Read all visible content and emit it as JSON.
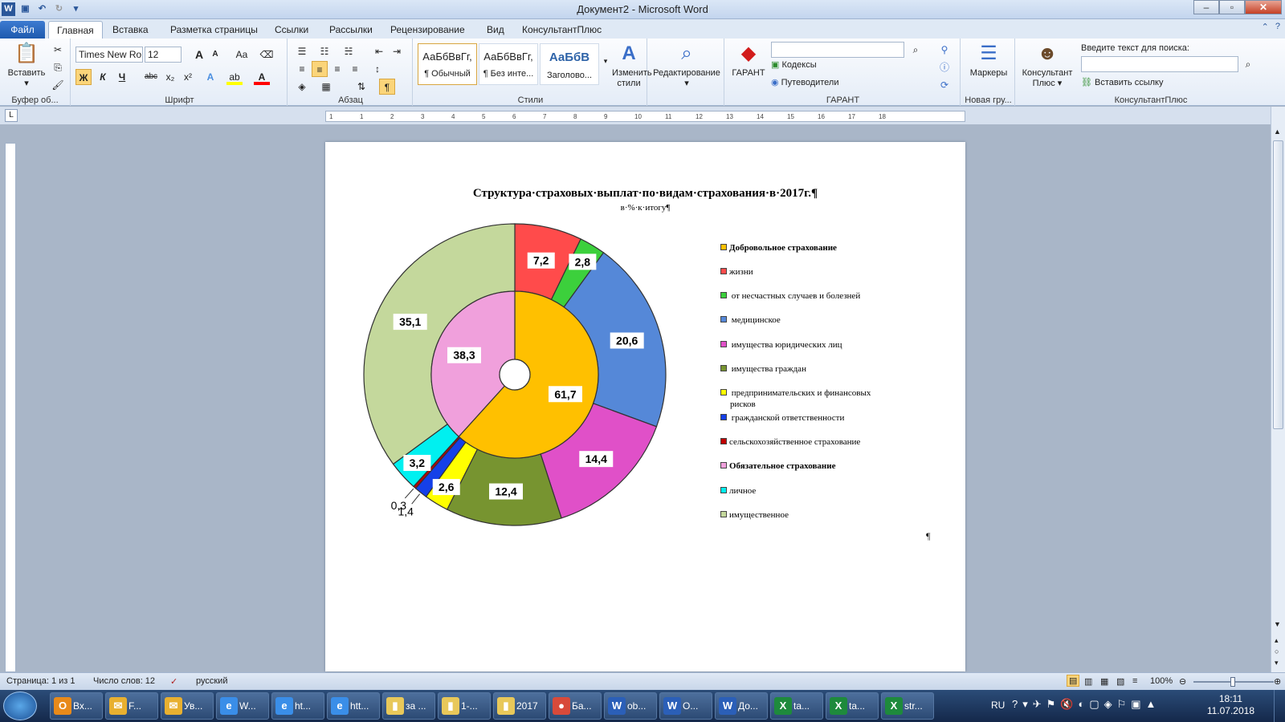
{
  "window": {
    "title": "Документ2 - Microsoft Word"
  },
  "tabs": [
    "Файл",
    "Главная",
    "Вставка",
    "Разметка страницы",
    "Ссылки",
    "Рассылки",
    "Рецензирование",
    "Вид",
    "КонсультантПлюс"
  ],
  "ribbon": {
    "clipboard": {
      "paste": "Вставить",
      "label": "Буфер об..."
    },
    "font": {
      "name": "Times New Ro",
      "size": "12",
      "label": "Шрифт",
      "bold": "Ж",
      "italic": "К",
      "underline": "Ч",
      "strike": "abc",
      "sub": "x₂",
      "sup": "x²",
      "grow": "A",
      "shrink": "A",
      "case": "Aa"
    },
    "paragraph": {
      "label": "Абзац",
      "marks": "¶"
    },
    "styles": {
      "items": [
        {
          "sample": "АаБбВвГг,",
          "name": "¶ Обычный"
        },
        {
          "sample": "АаБбВвГг,",
          "name": "¶ Без инте..."
        },
        {
          "sample": "АаБбВ",
          "name": "Заголово..."
        }
      ],
      "change": "Изменить стили",
      "label": "Стили"
    },
    "editing": {
      "label": "Редактирование"
    },
    "garant": {
      "btn": "ГАРАНТ",
      "codex": "Кодексы",
      "guides": "Путеводители",
      "label": "ГАРАНТ"
    },
    "new_group": {
      "btn": "Маркеры",
      "label": "Новая гру..."
    },
    "consultant": {
      "btn": "Консультант Плюс",
      "search_label": "Введите текст для поиска:",
      "insert_link": "Вставить ссылку",
      "label": "КонсультантПлюс"
    }
  },
  "ruler_ticks": [
    "1",
    "1",
    "2",
    "3",
    "4",
    "5",
    "6",
    "7",
    "8",
    "9",
    "10",
    "11",
    "12",
    "13",
    "14",
    "15",
    "16",
    "17",
    "18"
  ],
  "document": {
    "title": "Структура·страховых·выплат·по·видам·страхования·в·2017г.¶",
    "subtitle": "в·%·к·итогу¶",
    "end_mark": "¶"
  },
  "chart_data": {
    "type": "pie",
    "subtype": "doughnut-two-ring",
    "title": "Структура страховых выплат по видам страхования в 2017г.",
    "subtitle": "в % к итогу",
    "inner_ring": {
      "categories": [
        "Добровольное страхование",
        "Обязательное страхование"
      ],
      "values": [
        61.7,
        38.3
      ],
      "colors": [
        "#FFC000",
        "#F0A0DC"
      ]
    },
    "outer_ring": {
      "categories": [
        "жизни",
        "от несчастных случаев и болезней",
        "медицинское",
        "имущества юридических лиц",
        "имущества граждан",
        "предпринимательских и финансовых рисков",
        "гражданской ответственности",
        "сельскохозяйственное страхование",
        "личное",
        "имущественное"
      ],
      "values": [
        7.2,
        2.8,
        20.6,
        14.4,
        12.4,
        2.6,
        1.4,
        0.3,
        3.2,
        35.1
      ],
      "labels": [
        "7,2",
        "2,8",
        "20,6",
        "14,4",
        "12,4",
        "2,6",
        "1,4",
        "0,3",
        "3,2",
        "35,1"
      ],
      "colors": [
        "#FF4B4B",
        "#3CD03C",
        "#5588D8",
        "#E050C8",
        "#779430",
        "#FFFF00",
        "#1540E8",
        "#C00000",
        "#00F0F0",
        "#C4D89C"
      ]
    },
    "inner_labels": [
      "61,7",
      "38,3"
    ],
    "legend": {
      "placement": "right",
      "entries": [
        {
          "name": "Добровольное страхование",
          "color": "#FFC000",
          "header": true
        },
        {
          "name": "жизни",
          "color": "#FF4B4B"
        },
        {
          "name": " от несчастных случаев и болезней",
          "color": "#3CD03C"
        },
        {
          "name": " медицинское",
          "color": "#5588D8"
        },
        {
          "name": " имущества юридических лиц",
          "color": "#E050C8"
        },
        {
          "name": " имущества граждан",
          "color": "#779430"
        },
        {
          "name": " предпринимательских и финансовых",
          "color": "#FFFF00"
        },
        {
          "name": "рисков",
          "color": null
        },
        {
          "name": " гражданской ответственности",
          "color": "#1540E8"
        },
        {
          "name": "сельскохозяйственное страхование",
          "color": "#C00000"
        },
        {
          "name": "Обязательное страхование",
          "color": "#F0A0DC",
          "header": true
        },
        {
          "name": "личное",
          "color": "#00F0F0"
        },
        {
          "name": "имущественное",
          "color": "#C4D89C"
        }
      ]
    }
  },
  "status": {
    "page": "Страница: 1 из 1",
    "words": "Число слов: 12",
    "lang": "русский",
    "zoom": "100%"
  },
  "taskbar": {
    "items": [
      {
        "label": "Вх...",
        "icon": "outlook-icon",
        "glyph": "O",
        "color": "#e88a1a"
      },
      {
        "label": "F...",
        "icon": "mail-icon",
        "glyph": "✉",
        "color": "#e8b030"
      },
      {
        "label": "Ув...",
        "icon": "mail-icon",
        "glyph": "✉",
        "color": "#e8b030"
      },
      {
        "label": "W...",
        "icon": "ie-icon",
        "glyph": "e",
        "color": "#3a8ee8"
      },
      {
        "label": "ht...",
        "icon": "ie-icon",
        "glyph": "e",
        "color": "#3a8ee8"
      },
      {
        "label": "htt...",
        "icon": "ie-icon",
        "glyph": "e",
        "color": "#3a8ee8"
      },
      {
        "label": "за ...",
        "icon": "folder-icon",
        "glyph": "▮",
        "color": "#e8c85a"
      },
      {
        "label": "1-...",
        "icon": "folder-icon",
        "glyph": "▮",
        "color": "#e8c85a"
      },
      {
        "label": "2017",
        "icon": "folder-icon",
        "glyph": "▮",
        "color": "#e8c85a"
      },
      {
        "label": "Ба...",
        "icon": "chrome-icon",
        "glyph": "●",
        "color": "#d84a3a"
      },
      {
        "label": "ob...",
        "icon": "word-icon",
        "glyph": "W",
        "color": "#2b5fb8"
      },
      {
        "label": "О...",
        "icon": "word-icon",
        "glyph": "W",
        "color": "#2b5fb8"
      },
      {
        "label": "До...",
        "icon": "word-icon",
        "glyph": "W",
        "color": "#2b5fb8"
      },
      {
        "label": "ta...",
        "icon": "excel-icon",
        "glyph": "X",
        "color": "#1e8a3c"
      },
      {
        "label": "ta...",
        "icon": "excel-icon",
        "glyph": "X",
        "color": "#1e8a3c"
      },
      {
        "label": "str...",
        "icon": "excel-icon",
        "glyph": "X",
        "color": "#1e8a3c"
      }
    ],
    "lang": "RU",
    "time": "18:11",
    "date": "11.07.2018"
  }
}
